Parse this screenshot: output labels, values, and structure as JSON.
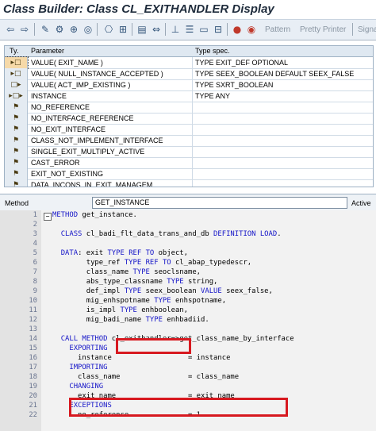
{
  "window": {
    "title": "Class Builder: Class CL_EXITHANDLER Display"
  },
  "toolbar": {
    "icons": [
      "arrow-left-icon",
      "arrow-right-icon",
      "pencil-glasses-icon",
      "activate-icon",
      "test-icon",
      "where-used-icon",
      "hierarchy-icon",
      "local-types-icon",
      "check-icon",
      "superclass-icon",
      "insert-icon",
      "class-doc-icon",
      "info-icon",
      "pattern-icon",
      "pretty-printer-icon"
    ],
    "pattern_label": "Pattern",
    "pretty_printer_label": "Pretty Printer",
    "signature_label": "Signa"
  },
  "params": {
    "headers": {
      "ty": "Ty.",
      "parameter": "Parameter",
      "spec": "Type spec."
    },
    "rows": [
      {
        "ty": "importing-icon",
        "name": "VALUE( EXIT_NAME )",
        "spec": "TYPE EXIT_DEF OPTIONAL",
        "selected": true
      },
      {
        "ty": "importing-icon",
        "name": "VALUE( NULL_INSTANCE_ACCEPTED )",
        "spec": "TYPE SEEX_BOOLEAN  DEFAULT SEEX_FALSE",
        "selected": false
      },
      {
        "ty": "exporting-icon",
        "name": "VALUE( ACT_IMP_EXISTING )",
        "spec": "TYPE SXRT_BOOLEAN",
        "selected": false
      },
      {
        "ty": "changing-icon",
        "name": "INSTANCE",
        "spec": "TYPE ANY",
        "selected": false
      },
      {
        "ty": "exception-icon",
        "name": "NO_REFERENCE",
        "spec": "",
        "selected": false
      },
      {
        "ty": "exception-icon",
        "name": "NO_INTERFACE_REFERENCE",
        "spec": "",
        "selected": false
      },
      {
        "ty": "exception-icon",
        "name": "NO_EXIT_INTERFACE",
        "spec": "",
        "selected": false
      },
      {
        "ty": "exception-icon",
        "name": "CLASS_NOT_IMPLEMENT_INTERFACE",
        "spec": "",
        "selected": false
      },
      {
        "ty": "exception-icon",
        "name": "SINGLE_EXIT_MULTIPLY_ACTIVE",
        "spec": "",
        "selected": false
      },
      {
        "ty": "exception-icon",
        "name": "CAST_ERROR",
        "spec": "",
        "selected": false
      },
      {
        "ty": "exception-icon",
        "name": "EXIT_NOT_EXISTING",
        "spec": "",
        "selected": false
      },
      {
        "ty": "exception-icon",
        "name": "DATA_INCONS_IN_EXIT_MANAGEM",
        "spec": "",
        "selected": false
      }
    ]
  },
  "method_bar": {
    "label": "Method",
    "value": "GET_INSTANCE",
    "status": "Active"
  },
  "code": {
    "lines": [
      {
        "n": "1",
        "text": "METHOD get_instance."
      },
      {
        "n": "2",
        "text": ""
      },
      {
        "n": "3",
        "text": "  CLASS cl_badi_flt_data_trans_and_db DEFINITION LOAD."
      },
      {
        "n": "4",
        "text": ""
      },
      {
        "n": "5",
        "text": "  DATA: exit TYPE REF TO object,"
      },
      {
        "n": "6",
        "text": "        type_ref TYPE REF TO cl_abap_typedescr,"
      },
      {
        "n": "7",
        "text": "        class_name TYPE seoclsname,"
      },
      {
        "n": "8",
        "text": "        abs_type_classname TYPE string,"
      },
      {
        "n": "9",
        "text": "        def_impl TYPE seex_boolean VALUE seex_false,"
      },
      {
        "n": "10",
        "text": "        mig_enhspotname TYPE enhspotname,"
      },
      {
        "n": "11",
        "text": "        is_impl TYPE enhboolean,"
      },
      {
        "n": "12",
        "text": "        mig_badi_name TYPE enhbadiid."
      },
      {
        "n": "13",
        "text": ""
      },
      {
        "n": "14",
        "text": "  CALL METHOD cl_exithandler=>get_class_name_by_interface"
      },
      {
        "n": "15",
        "text": "    EXPORTING"
      },
      {
        "n": "16",
        "text": "      instance                  = instance"
      },
      {
        "n": "17",
        "text": "    IMPORTING"
      },
      {
        "n": "18",
        "text": "      class_name                = class_name"
      },
      {
        "n": "19",
        "text": "    CHANGING"
      },
      {
        "n": "20",
        "text": "      exit_name                 = exit_name"
      },
      {
        "n": "21",
        "text": "    EXCEPTIONS"
      },
      {
        "n": "22",
        "text": "      no_reference              = 1"
      }
    ],
    "fold_marker": "−"
  }
}
